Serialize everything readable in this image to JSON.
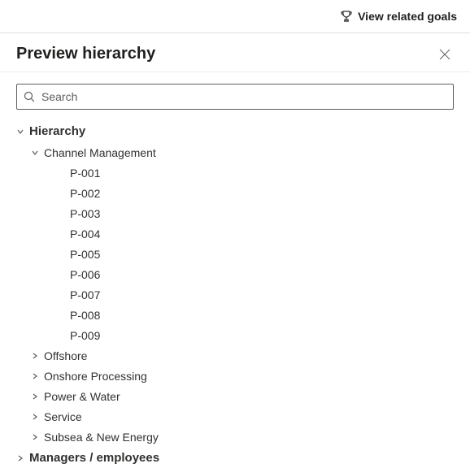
{
  "topbar": {
    "view_goals": "View related goals"
  },
  "panel": {
    "title": "Preview hierarchy"
  },
  "search": {
    "placeholder": "Search"
  },
  "tree": {
    "root_label": "Hierarchy",
    "channel_mgmt": "Channel Management",
    "p001": "P-001",
    "p002": "P-002",
    "p003": "P-003",
    "p004": "P-004",
    "p005": "P-005",
    "p006": "P-006",
    "p007": "P-007",
    "p008": "P-008",
    "p009": "P-009",
    "offshore": "Offshore",
    "onshore": "Onshore Processing",
    "power": "Power & Water",
    "service": "Service",
    "subsea": "Subsea & New Energy",
    "managers": "Managers / employees"
  }
}
